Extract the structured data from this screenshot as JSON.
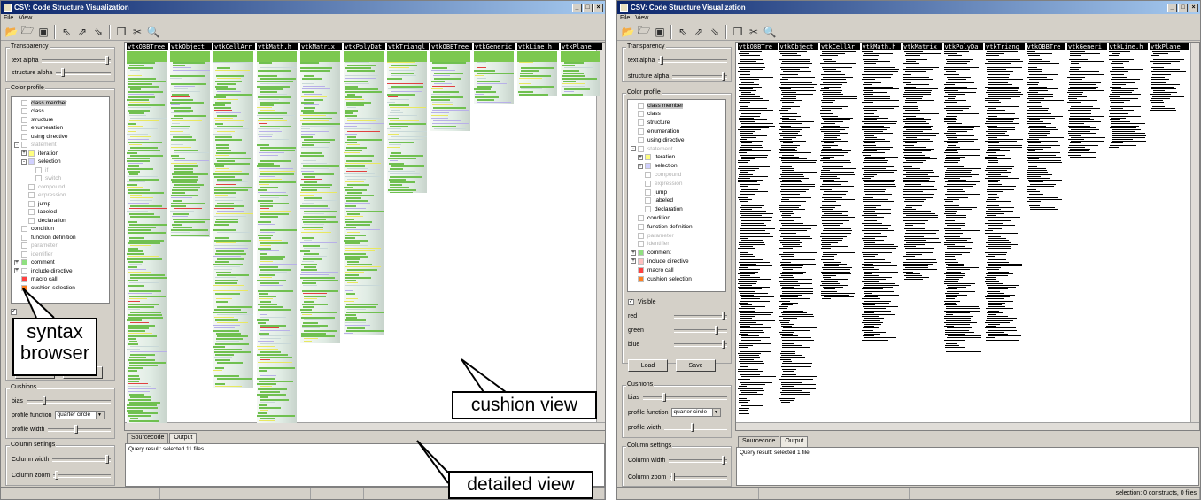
{
  "window": {
    "title": "CSV: Code Structure Visualization",
    "menu": [
      "File",
      "View"
    ]
  },
  "toolbar_icons": [
    "folder-open-icon",
    "folder-icon",
    "save-icon",
    "pointer-icon",
    "select-icon",
    "select-multi-icon",
    "copy-icon",
    "cut-icon",
    "zoom-icon"
  ],
  "transparency": {
    "title": "Transparency",
    "text_alpha_label": "text alpha",
    "structure_alpha_label": "structure alpha"
  },
  "color_profile": {
    "title": "Color profile",
    "items": [
      {
        "label": "class member",
        "color": "#ffffff",
        "dim": false,
        "indent": 0,
        "expander": "",
        "selected": true
      },
      {
        "label": "class",
        "color": "#ffffff",
        "dim": false,
        "indent": 0,
        "expander": ""
      },
      {
        "label": "structure",
        "color": "#ffffff",
        "dim": false,
        "indent": 0,
        "expander": ""
      },
      {
        "label": "enumeration",
        "color": "#ffffff",
        "dim": false,
        "indent": 0,
        "expander": ""
      },
      {
        "label": "using directive",
        "color": "#ffffff",
        "dim": false,
        "indent": 0,
        "expander": ""
      },
      {
        "label": "statement",
        "color": "#ffffff",
        "dim": true,
        "indent": 0,
        "expander": "-"
      },
      {
        "label": "iteration",
        "color": "#ffff80",
        "dim": false,
        "indent": 1,
        "expander": "+"
      },
      {
        "label": "selection",
        "color": "#d0d0ff",
        "dim": false,
        "indent": 1,
        "expander": "+"
      },
      {
        "label": "compound",
        "color": "#ffffff",
        "dim": true,
        "indent": 1,
        "expander": ""
      },
      {
        "label": "expression",
        "color": "#ffffff",
        "dim": true,
        "indent": 1,
        "expander": ""
      },
      {
        "label": "jump",
        "color": "#ffffff",
        "dim": false,
        "indent": 1,
        "expander": ""
      },
      {
        "label": "labeled",
        "color": "#ffffff",
        "dim": false,
        "indent": 1,
        "expander": ""
      },
      {
        "label": "declaration",
        "color": "#ffffff",
        "dim": false,
        "indent": 1,
        "expander": ""
      },
      {
        "label": "condition",
        "color": "#ffffff",
        "dim": false,
        "indent": 0,
        "expander": ""
      },
      {
        "label": "function definition",
        "color": "#ffffff",
        "dim": false,
        "indent": 0,
        "expander": ""
      },
      {
        "label": "parameter",
        "color": "#ffffff",
        "dim": true,
        "indent": 0,
        "expander": ""
      },
      {
        "label": "identifier",
        "color": "#ffffff",
        "dim": true,
        "indent": 0,
        "expander": ""
      },
      {
        "label": "comment",
        "color": "#90e080",
        "dim": false,
        "indent": 0,
        "expander": "+"
      },
      {
        "label": "include directive",
        "color": "#ffc0c0",
        "dim": false,
        "indent": 0,
        "expander": "+"
      },
      {
        "label": "macro call",
        "color": "#ff4040",
        "dim": false,
        "indent": 0,
        "expander": ""
      },
      {
        "label": "cushion selection",
        "color": "#ff8020",
        "dim": false,
        "indent": 0,
        "expander": ""
      }
    ],
    "win1_items": [
      {
        "label": "class member",
        "color": "#ffffff",
        "dim": false,
        "indent": 0,
        "expander": "",
        "selected": true
      },
      {
        "label": "class",
        "color": "#ffffff",
        "dim": false,
        "indent": 0,
        "expander": ""
      },
      {
        "label": "structure",
        "color": "#ffffff",
        "dim": false,
        "indent": 0,
        "expander": ""
      },
      {
        "label": "enumeration",
        "color": "#ffffff",
        "dim": false,
        "indent": 0,
        "expander": ""
      },
      {
        "label": "using directive",
        "color": "#ffffff",
        "dim": false,
        "indent": 0,
        "expander": ""
      },
      {
        "label": "statement",
        "color": "#ffffff",
        "dim": true,
        "indent": 0,
        "expander": "-"
      },
      {
        "label": "iteration",
        "color": "#ffff80",
        "dim": false,
        "indent": 1,
        "expander": "+"
      },
      {
        "label": "selection",
        "color": "#d0d0ff",
        "dim": false,
        "indent": 1,
        "expander": "-"
      },
      {
        "label": "if",
        "color": "#ffffff",
        "dim": true,
        "indent": 2,
        "expander": ""
      },
      {
        "label": "switch",
        "color": "#ffffff",
        "dim": true,
        "indent": 2,
        "expander": ""
      },
      {
        "label": "compound",
        "color": "#ffffff",
        "dim": true,
        "indent": 1,
        "expander": ""
      },
      {
        "label": "expression",
        "color": "#ffffff",
        "dim": true,
        "indent": 1,
        "expander": ""
      },
      {
        "label": "jump",
        "color": "#ffffff",
        "dim": false,
        "indent": 1,
        "expander": ""
      },
      {
        "label": "labeled",
        "color": "#ffffff",
        "dim": false,
        "indent": 1,
        "expander": ""
      },
      {
        "label": "declaration",
        "color": "#ffffff",
        "dim": false,
        "indent": 1,
        "expander": ""
      },
      {
        "label": "condition",
        "color": "#ffffff",
        "dim": false,
        "indent": 0,
        "expander": ""
      },
      {
        "label": "function definition",
        "color": "#ffffff",
        "dim": false,
        "indent": 0,
        "expander": ""
      },
      {
        "label": "parameter",
        "color": "#ffffff",
        "dim": true,
        "indent": 0,
        "expander": ""
      },
      {
        "label": "identifier",
        "color": "#ffffff",
        "dim": true,
        "indent": 0,
        "expander": ""
      },
      {
        "label": "comment",
        "color": "#90e080",
        "dim": false,
        "indent": 0,
        "expander": "+"
      },
      {
        "label": "include directive",
        "color": "#ffffff",
        "dim": false,
        "indent": 0,
        "expander": "+"
      },
      {
        "label": "macro call",
        "color": "#ff4040",
        "dim": false,
        "indent": 0,
        "expander": ""
      },
      {
        "label": "cushion selection",
        "color": "#ff8020",
        "dim": false,
        "indent": 0,
        "expander": ""
      }
    ]
  },
  "visibility": {
    "visible_label": "Visible",
    "red_label": "red",
    "green_label": "green",
    "blue_label": "blue"
  },
  "buttons": {
    "load": "Load",
    "save": "Save"
  },
  "cushions": {
    "title": "Cushions",
    "bias_label": "bias",
    "profile_function_label": "profile function",
    "profile_function_value": "quarter circle",
    "profile_width_label": "profile width"
  },
  "column_settings": {
    "title": "Column settings",
    "column_width_label": "Column width",
    "column_zoom_label": "Column zoom"
  },
  "columns_win1": [
    "vtkOBBTree",
    "vtkObject",
    "vtkCellArr",
    "vtkMath.h",
    "vtkMatrix",
    "vtkPolyDat",
    "vtkTriangl",
    "vtkOBBTree",
    "vtkGeneric",
    "vtkLine.h",
    "vtkPlane"
  ],
  "columns_win2": [
    "vtkOBBTre",
    "vtkObject",
    "vtkCellAr",
    "vtkMath.h",
    "vtkMatrix",
    "vtkPolyDa",
    "vtkTriang",
    "vtkOBBTre",
    "vtkGeneri",
    "vtkLine.h",
    "vtkPlane"
  ],
  "tabs": [
    "Sourcecode",
    "Output"
  ],
  "output_win1": "Query result: selected 11 files",
  "output_win2": "Query result: selected 1 file",
  "status_win2": "selection: 0 constructs, 0 files",
  "callouts": {
    "syntax_browser": "syntax browser",
    "cushion_view": "cushion view",
    "detailed_view": "detailed view"
  }
}
